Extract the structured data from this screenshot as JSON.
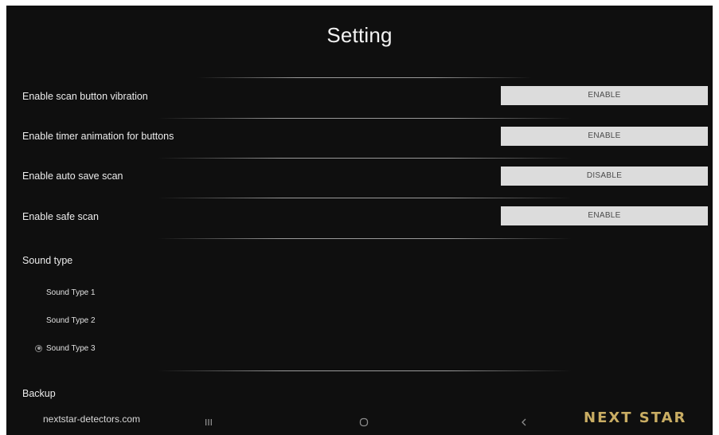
{
  "header": {
    "title": "Setting"
  },
  "settings": [
    {
      "label": "Enable scan button vibration",
      "button": "ENABLE"
    },
    {
      "label": "Enable timer animation for buttons",
      "button": "ENABLE"
    },
    {
      "label": "Enable auto save scan",
      "button": "DISABLE"
    },
    {
      "label": "Enable safe scan",
      "button": "ENABLE"
    }
  ],
  "sound": {
    "heading": "Sound type",
    "options": [
      {
        "label": "Sound Type 1",
        "selected": false
      },
      {
        "label": "Sound Type 2",
        "selected": false
      },
      {
        "label": "Sound Type 3",
        "selected": true
      }
    ]
  },
  "backup": {
    "heading": "Backup"
  },
  "footer": {
    "website": "nextstar-detectors.com",
    "brand": "NEXT STAR",
    "nav": {
      "recents_icon": "recents-icon",
      "home_icon": "home-icon",
      "back_icon": "back-icon"
    }
  },
  "colors": {
    "background": "#0f0f0f",
    "button_bg": "#dcdcdc",
    "button_text": "#4a4a4a",
    "brand": "#c9ad63"
  }
}
